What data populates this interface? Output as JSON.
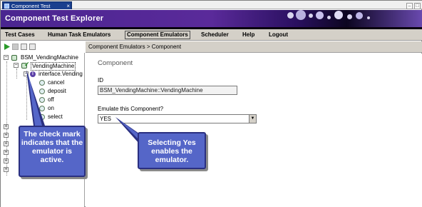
{
  "window": {
    "tab_title": "Component Test Explorer",
    "app_title": "Component Test Explorer"
  },
  "menu": {
    "items": [
      "Test Cases",
      "Human Task Emulators",
      "Component Emulators",
      "Scheduler",
      "Help",
      "Logout"
    ],
    "active": "Component Emulators"
  },
  "breadcrumb": "Component Emulators > Component",
  "tree": {
    "root": "BSM_VendingMachine",
    "component": "VendingMachine",
    "interface": "interface.Vending",
    "operations": [
      "cancel",
      "deposit",
      "off",
      "on",
      "select"
    ]
  },
  "form": {
    "section_title": "Component",
    "id_label": "ID",
    "id_value": "BSM_VendingMachine::VendingMachine",
    "emulate_label": "Emulate this Component?",
    "emulate_value": "YES"
  },
  "callouts": {
    "check_mark": "The check mark indicates that the emulator is active.",
    "selecting_yes": "Selecting Yes enables the emulator."
  },
  "colors": {
    "banner": "#4a2590",
    "tab": "#1a3f8e",
    "callout": "#5566c8"
  }
}
